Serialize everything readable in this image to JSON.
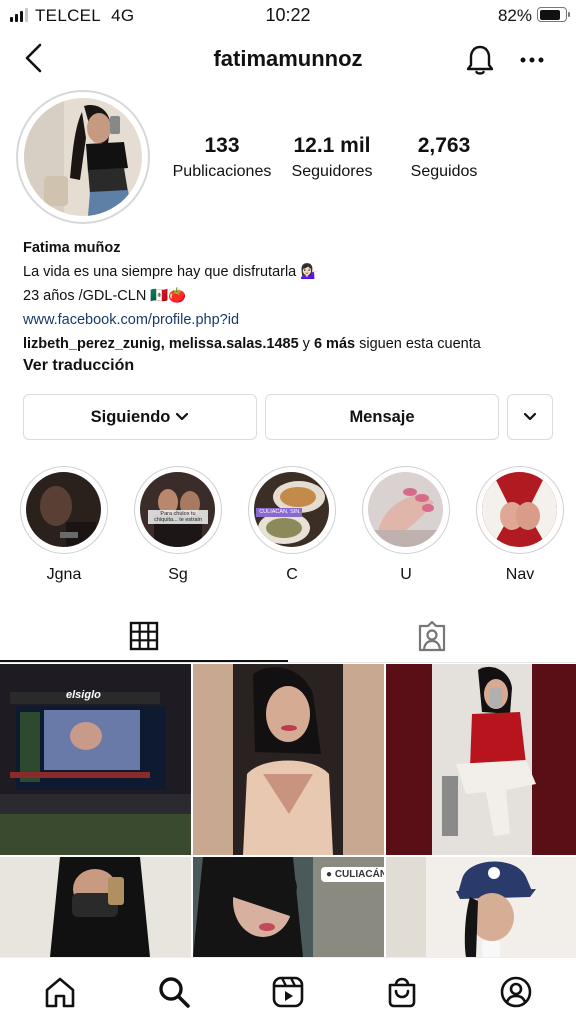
{
  "status_bar": {
    "carrier": "TELCEL",
    "network": "4G",
    "time": "10:22",
    "battery": "82%",
    "battery_level": 0.82
  },
  "header": {
    "username": "fatimamunnoz",
    "back_icon": "chevron-left-icon",
    "bell_icon": "bell-icon",
    "more_icon": "more-horizontal-icon"
  },
  "stats": [
    {
      "value": "133",
      "label": "Publicaciones"
    },
    {
      "value": "12.1 mil",
      "label": "Seguidores"
    },
    {
      "value": "2,763",
      "label": "Seguidos"
    }
  ],
  "bio": {
    "name": "Fatima muñoz",
    "line1": "La vida es una siempre hay que disfrutarla 💁🏻‍♀️",
    "line2": "23 años /GDL-CLN 🇲🇽🍅",
    "link": "www.facebook.com/profile.php?id",
    "followed_by_users": "lizbeth_perez_zunig, melissa.salas.1485",
    "followed_by_and": " y ",
    "followed_by_more": "6 más",
    "followed_by_suffix": " siguen esta cuenta",
    "translate": "Ver traducción"
  },
  "actions": {
    "following": "Siguiendo",
    "message": "Mensaje"
  },
  "highlights": [
    {
      "label": "Jgna"
    },
    {
      "label": "Sg"
    },
    {
      "label": "C"
    },
    {
      "label": "U"
    },
    {
      "label": "Nav"
    }
  ],
  "highlight_overlays": {
    "sg_caption": "Para chulos tu chiquita... te estrain",
    "c_location": "CULIACÁN, SIN."
  },
  "posts": {
    "p1_sign": "elsiglo",
    "p5_location": "CULIACÁN"
  },
  "tabs": {
    "grid_icon": "grid-icon",
    "tagged_icon": "tagged-person-icon"
  },
  "bottom_nav": [
    "home-icon",
    "search-icon",
    "reels-icon",
    "shop-icon",
    "profile-icon"
  ],
  "colors": {
    "link": "#1a3a6b",
    "border": "#dbdbdb",
    "text": "#111111"
  }
}
